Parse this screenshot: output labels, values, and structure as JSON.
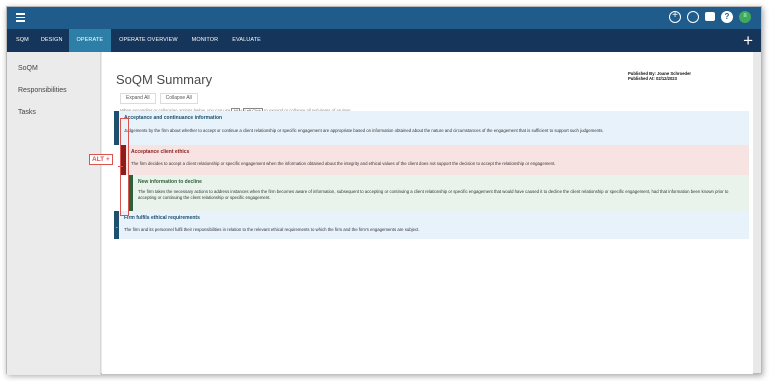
{
  "topbar": {
    "icons": [
      "add-circle-icon",
      "chat-icon",
      "message-icon",
      "help-icon",
      "user-avatar-icon"
    ],
    "help_glyph": "?",
    "user_glyph": "≡"
  },
  "nav": {
    "tabs": [
      "SQM",
      "DESIGN",
      "OPERATE",
      "OPERATE OVERVIEW",
      "MONITOR",
      "EVALUATE"
    ],
    "active": "OPERATE",
    "plus": "+"
  },
  "sidebar": {
    "items": [
      "SoQM",
      "Responsibilities",
      "Tasks"
    ]
  },
  "page": {
    "title": "SoQM Summary",
    "published_by": "Published By: Joane Schroeder",
    "published_at": "Published At: 02/12/2023",
    "expand_all": "Expand All",
    "collapse_all": "Collapse All",
    "hint_pre": "When expanding or collapsing actions below, you can use",
    "hint_key1": "Alt",
    "hint_plus": "+",
    "hint_key2": "Left Click",
    "hint_post": "to expand or collapse all sub-items of an item."
  },
  "requirements": [
    {
      "title": "Acceptance and continuance information",
      "description": "Judgements by the firm about whether to accept or continue a client relationship or specific engagement are appropriate based on information obtained about the nature and circumstances of the engagement that is sufficient to support such judgements."
    },
    {
      "title": "Acceptance client ethics",
      "description": "The firm decides to accept a client relationship or specific engagement when the information obtained about the integrity and ethical values of the client does not support the decision to accept the relationship or engagement."
    },
    {
      "title": "New information to decline",
      "description": "The firm takes the necessary actions to address instances when the firm becomes aware of information, subsequent to accepting or continuing a client relationship or specific engagement that would have caused it to decline the client relationship or specific engagement, had that information been known prior to accepting or continuing the client relationship or specific engagement."
    },
    {
      "title": "Firm fulfils ethical requirements",
      "description": "The firm and its personnel fulfil their responsibilities in relation to the relevant ethical requirements to which the firm and the firm's engagements are subject."
    }
  ],
  "callout": {
    "label": "ALT +"
  },
  "colors": {
    "topbar": "#1f5c8b",
    "navbar": "#15365a",
    "active_tab": "#2e7fa8",
    "blue_bar": "#1e4f6e",
    "blue_bg": "#e8f2fa",
    "red_bar": "#8b1d1d",
    "red_bg": "#f8e3e3",
    "green_bar": "#2f5e3a",
    "green_bg": "#e9f3ec",
    "callout": "#d9534f"
  }
}
